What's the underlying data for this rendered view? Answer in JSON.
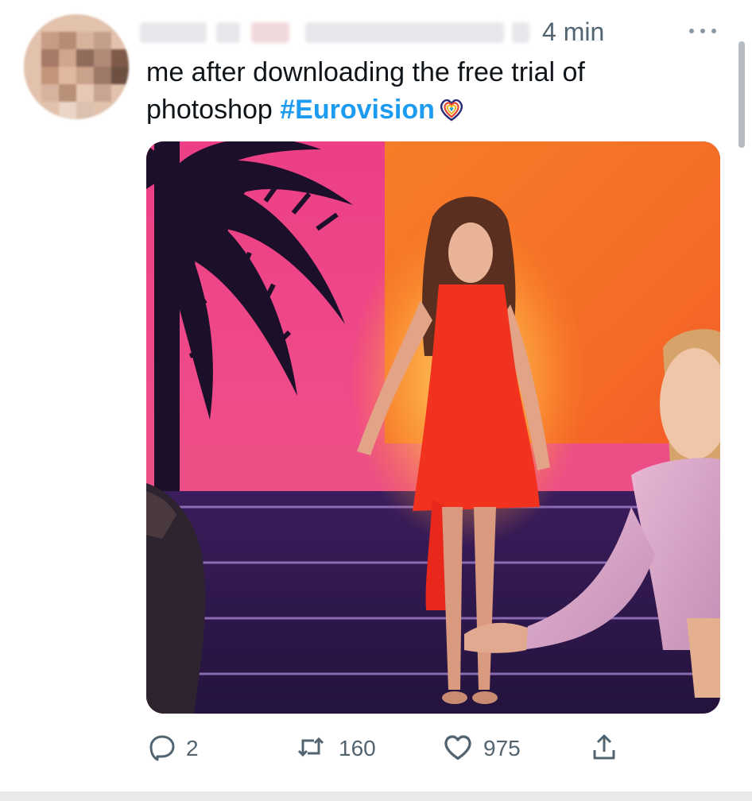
{
  "tweet": {
    "timestamp": "4 min",
    "text_main": "me after downloading the free trial of photoshop ",
    "hashtag": "#Eurovision",
    "emoji_icon": "eurovision-heart-icon",
    "more_icon": "more-dots-icon"
  },
  "actions": {
    "reply": {
      "icon": "reply-icon",
      "count": "2"
    },
    "retweet": {
      "icon": "retweet-icon",
      "count": "160"
    },
    "like": {
      "icon": "heart-icon",
      "count": "975"
    },
    "share": {
      "icon": "share-icon"
    }
  },
  "colors": {
    "link": "#1d9bf0",
    "secondary_text": "#536471",
    "primary_text": "#0f1419"
  }
}
